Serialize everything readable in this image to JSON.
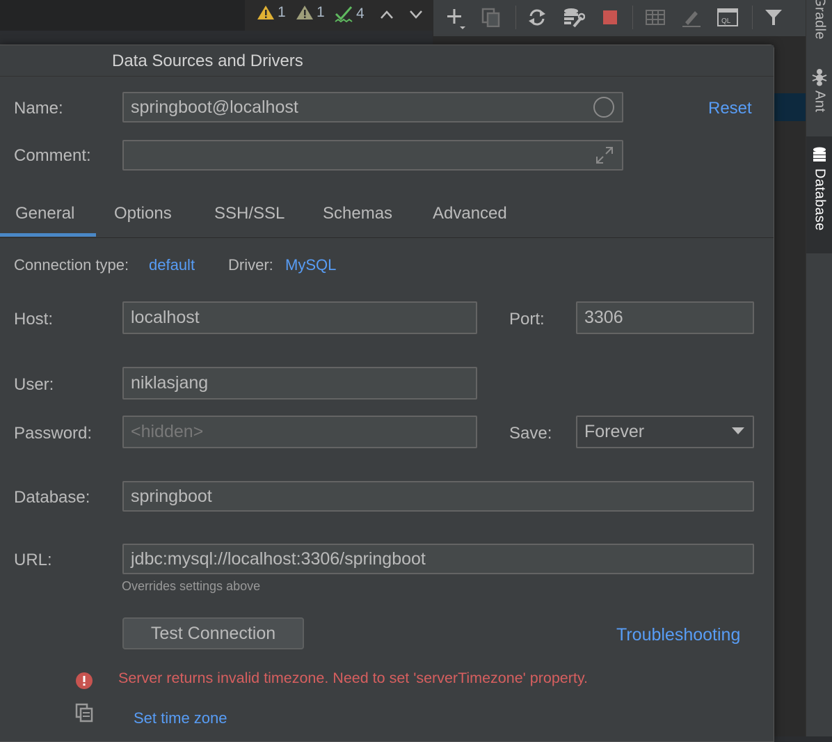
{
  "ide": {
    "inspections": [
      {
        "icon": "warning-icon",
        "count": "1",
        "color": "#e0b134"
      },
      {
        "icon": "weak-warning-icon",
        "count": "1",
        "color": "#9e9e7a"
      },
      {
        "icon": "typo-check-icon",
        "count": "4",
        "color": "#5fb95f"
      }
    ],
    "side_tabs": {
      "gradle": "Gradle",
      "ant": "Ant",
      "database": "Database"
    }
  },
  "dialog": {
    "title": "Data Sources and Drivers",
    "name_label": "Name:",
    "name_value": "springboot@localhost",
    "reset_label": "Reset",
    "comment_label": "Comment:",
    "comment_value": "",
    "tabs": [
      "General",
      "Options",
      "SSH/SSL",
      "Schemas",
      "Advanced"
    ],
    "active_tab": "General",
    "connection_type_label": "Connection type:",
    "connection_type_value": "default",
    "driver_label": "Driver:",
    "driver_value": "MySQL",
    "host_label": "Host:",
    "host_value": "localhost",
    "port_label": "Port:",
    "port_value": "3306",
    "user_label": "User:",
    "user_value": "niklasjang",
    "password_label": "Password:",
    "password_placeholder": "<hidden>",
    "save_label": "Save:",
    "save_value": "Forever",
    "database_label": "Database:",
    "database_value": "springboot",
    "url_label": "URL:",
    "url_value": "jdbc:mysql://localhost:3306/springboot",
    "url_hint": "Overrides settings above",
    "test_connection_label": "Test Connection",
    "troubleshooting_label": "Troubleshooting",
    "error_message": "Server returns invalid timezone. Need to set 'serverTimezone' property.",
    "set_time_zone_label": "Set time zone"
  },
  "colors": {
    "accent": "#589df6",
    "error": "#d75f5f",
    "tab_underline": "#4a88c7",
    "stop": "#c75450"
  }
}
